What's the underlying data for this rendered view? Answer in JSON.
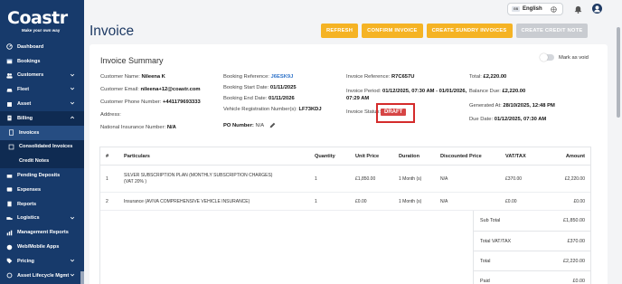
{
  "brand": {
    "name": "Coastr",
    "tagline": "Make your own way"
  },
  "sidebar": {
    "items": [
      {
        "label": "Dashboard",
        "icon": "dashboard-icon"
      },
      {
        "label": "Bookings",
        "icon": "calendar-icon"
      },
      {
        "label": "Customers",
        "icon": "users-icon",
        "expandable": true
      },
      {
        "label": "Fleet",
        "icon": "car-icon",
        "expandable": true
      },
      {
        "label": "Asset",
        "icon": "box-icon",
        "expandable": true
      },
      {
        "label": "Billing",
        "icon": "billing-icon",
        "expandable": true,
        "expanded": true
      }
    ],
    "billing_sub": [
      {
        "label": "Invoices",
        "selected": true
      },
      {
        "label": "Consolidated Invoices"
      },
      {
        "label": "Credit Notes"
      }
    ],
    "items_after": [
      {
        "label": "Pending Deposits",
        "icon": "deposit-icon"
      },
      {
        "label": "Expenses",
        "icon": "expense-icon"
      },
      {
        "label": "Reports",
        "icon": "report-icon"
      },
      {
        "label": "Logistics",
        "icon": "truck-icon",
        "expandable": true
      },
      {
        "label": "Management Reports",
        "icon": "chart-icon"
      },
      {
        "label": "Web/Mobile Apps",
        "icon": "globe-icon"
      },
      {
        "label": "Pricing",
        "icon": "tag-icon",
        "expandable": true
      },
      {
        "label": "Asset Lifecycle Mgmt",
        "icon": "lifecycle-icon",
        "expandable": true
      }
    ]
  },
  "topbar": {
    "language": "English",
    "flag_text": "GB"
  },
  "page": {
    "title": "Invoice"
  },
  "actions": {
    "refresh": "REFRESH",
    "confirm": "CONFIRM INVOICE",
    "sundry": "CREATE SUNDRY INVOICES",
    "credit": "CREATE CREDIT NOTE"
  },
  "summary": {
    "title": "Invoice Summary",
    "mark_void": "Mark as void",
    "customer_name_label": "Customer Name:",
    "customer_name": "Nileena K",
    "customer_email_label": "Customer Email:",
    "customer_email": "nileena+12@coastr.com",
    "customer_phone_label": "Customer Phone Number:",
    "customer_phone": "+441179693333",
    "address_label": "Address:",
    "ni_label": "National Insurance Number:",
    "ni": "N/A",
    "booking_ref_label": "Booking Reference:",
    "booking_ref": "J6ESK9J",
    "booking_start_label": "Booking Start Date:",
    "booking_start": "01/11/2025",
    "booking_end_label": "Booking End Date:",
    "booking_end": "01/11/2026",
    "vrn_label": "Vehicle Registration Number(s):",
    "vrn": "LF73KDJ",
    "po_label": "PO Number:",
    "po": "N/A",
    "invoice_ref_label": "Invoice Reference:",
    "invoice_ref": "R7C657U",
    "invoice_period_label": "Invoice Period:",
    "invoice_period_1": "01/12/2025, 07:30 AM - 01/01/2026,",
    "invoice_period_2": "07:29 AM",
    "invoice_status_label": "Invoice Status:",
    "invoice_status": "DRAFT",
    "total_label": "Total:",
    "total": "£2,220.00",
    "balance_label": "Balance Due:",
    "balance": "£2,220.00",
    "generated_label": "Generated At:",
    "generated": "28/10/2025, 12:48 PM",
    "due_label": "Due Date:",
    "due": "01/12/2025, 07:30 AM"
  },
  "table": {
    "headers": {
      "num": "#",
      "part": "Particulars",
      "qty": "Quantity",
      "price": "Unit Price",
      "dur": "Duration",
      "disc": "Discounted Price",
      "vat": "VAT/TAX",
      "amt": "Amount"
    },
    "rows": [
      {
        "num": "1",
        "part_1": "SILVER SUBSCRIPTION PLAN (MONTHLY SUBSCRIPTION CHARGES)",
        "part_2": "(VAT 20% )",
        "qty": "1",
        "price": "£1,850.00",
        "dur": "1 Month (s)",
        "disc": "N/A",
        "vat": "£370.00",
        "amt": "£2,220.00"
      },
      {
        "num": "2",
        "part_1": "Insurance (AVIVA COMPREHENSIVE VEHICLE INSURANCE)",
        "part_2": "",
        "qty": "1",
        "price": "£0.00",
        "dur": "1 Month (s)",
        "disc": "N/A",
        "vat": "£0.00",
        "amt": "£0.00"
      }
    ],
    "totals": [
      {
        "label": "Sub Total",
        "value": "£1,850.00"
      },
      {
        "label": "Total VAT/TAX",
        "value": "£370.00"
      },
      {
        "label": "Total",
        "value": "£2,220.00"
      },
      {
        "label": "Paid",
        "value": "£0.00"
      }
    ]
  },
  "colors": {
    "sidebar": "#173a6b",
    "accent": "#f5b324",
    "draft": "#d64545",
    "link": "#2f73c9"
  }
}
